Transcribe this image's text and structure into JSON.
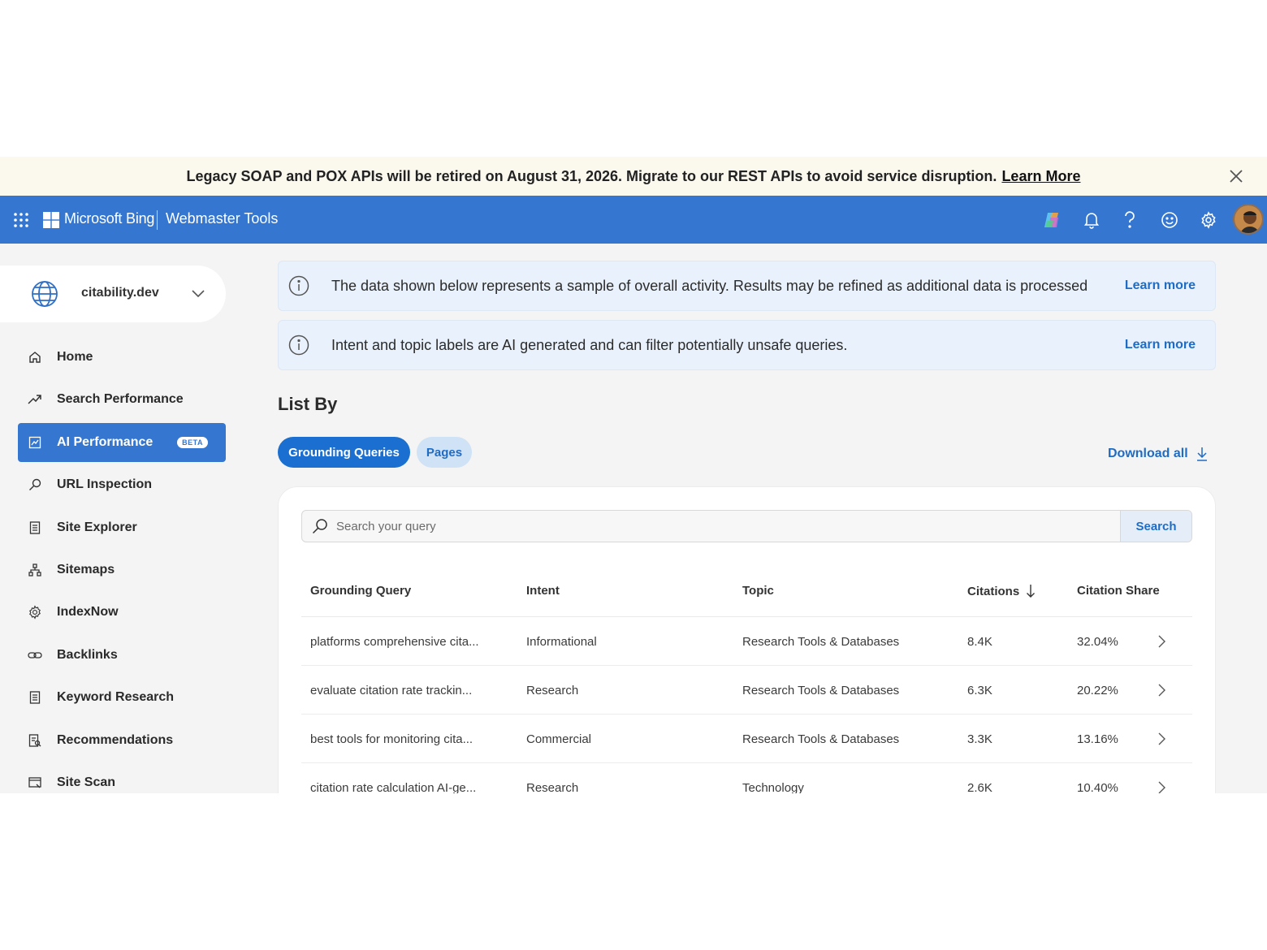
{
  "banner": {
    "message": "Legacy SOAP and POX APIs will be retired on August 31, 2026. Migrate to our REST APIs to avoid service disruption.",
    "link": "Learn More"
  },
  "topbar": {
    "brand": "Microsoft Bing",
    "product": "Webmaster Tools",
    "accent_color": "#3576d0"
  },
  "site_selector": {
    "name": "citability.dev"
  },
  "sidebar": {
    "items": [
      {
        "label": "Home",
        "icon": "home-icon"
      },
      {
        "label": "Search Performance",
        "icon": "trend-icon"
      },
      {
        "label": "AI Performance",
        "icon": "ai-chart-icon",
        "badge": "BETA",
        "active": true
      },
      {
        "label": "URL Inspection",
        "icon": "search-icon"
      },
      {
        "label": "Site Explorer",
        "icon": "document-icon"
      },
      {
        "label": "Sitemaps",
        "icon": "sitemap-icon"
      },
      {
        "label": "IndexNow",
        "icon": "gear-icon"
      },
      {
        "label": "Backlinks",
        "icon": "link-icon"
      },
      {
        "label": "Keyword Research",
        "icon": "document-icon"
      },
      {
        "label": "Recommendations",
        "icon": "recommendations-icon"
      },
      {
        "label": "Site Scan",
        "icon": "scan-icon"
      }
    ]
  },
  "notices": [
    {
      "text": "The data shown below represents a sample of overall activity. Results may be refined as additional data is processed",
      "link": "Learn more"
    },
    {
      "text": "Intent and topic labels are AI generated and can filter potentially unsafe queries.",
      "link": "Learn more"
    }
  ],
  "list_by": {
    "title": "List By",
    "tabs": [
      "Grounding Queries",
      "Pages"
    ],
    "active_tab": "Grounding Queries",
    "download": "Download all"
  },
  "search": {
    "placeholder": "Search your query",
    "button": "Search"
  },
  "table": {
    "columns": [
      "Grounding Query",
      "Intent",
      "Topic",
      "Citations",
      "Citation Share"
    ],
    "sort_column": "Citations",
    "sort_direction": "descending",
    "rows": [
      [
        "platforms comprehensive cita...",
        "Informational",
        "Research Tools & Databases",
        "8.4K",
        "32.04%"
      ],
      [
        "evaluate citation rate trackin...",
        "Research",
        "Research Tools & Databases",
        "6.3K",
        "20.22%"
      ],
      [
        "best tools for monitoring cita...",
        "Commercial",
        "Research Tools & Databases",
        "3.3K",
        "13.16%"
      ],
      [
        "citation rate calculation AI-ge...",
        "Research",
        "Technology",
        "2.6K",
        "10.40%"
      ]
    ]
  }
}
